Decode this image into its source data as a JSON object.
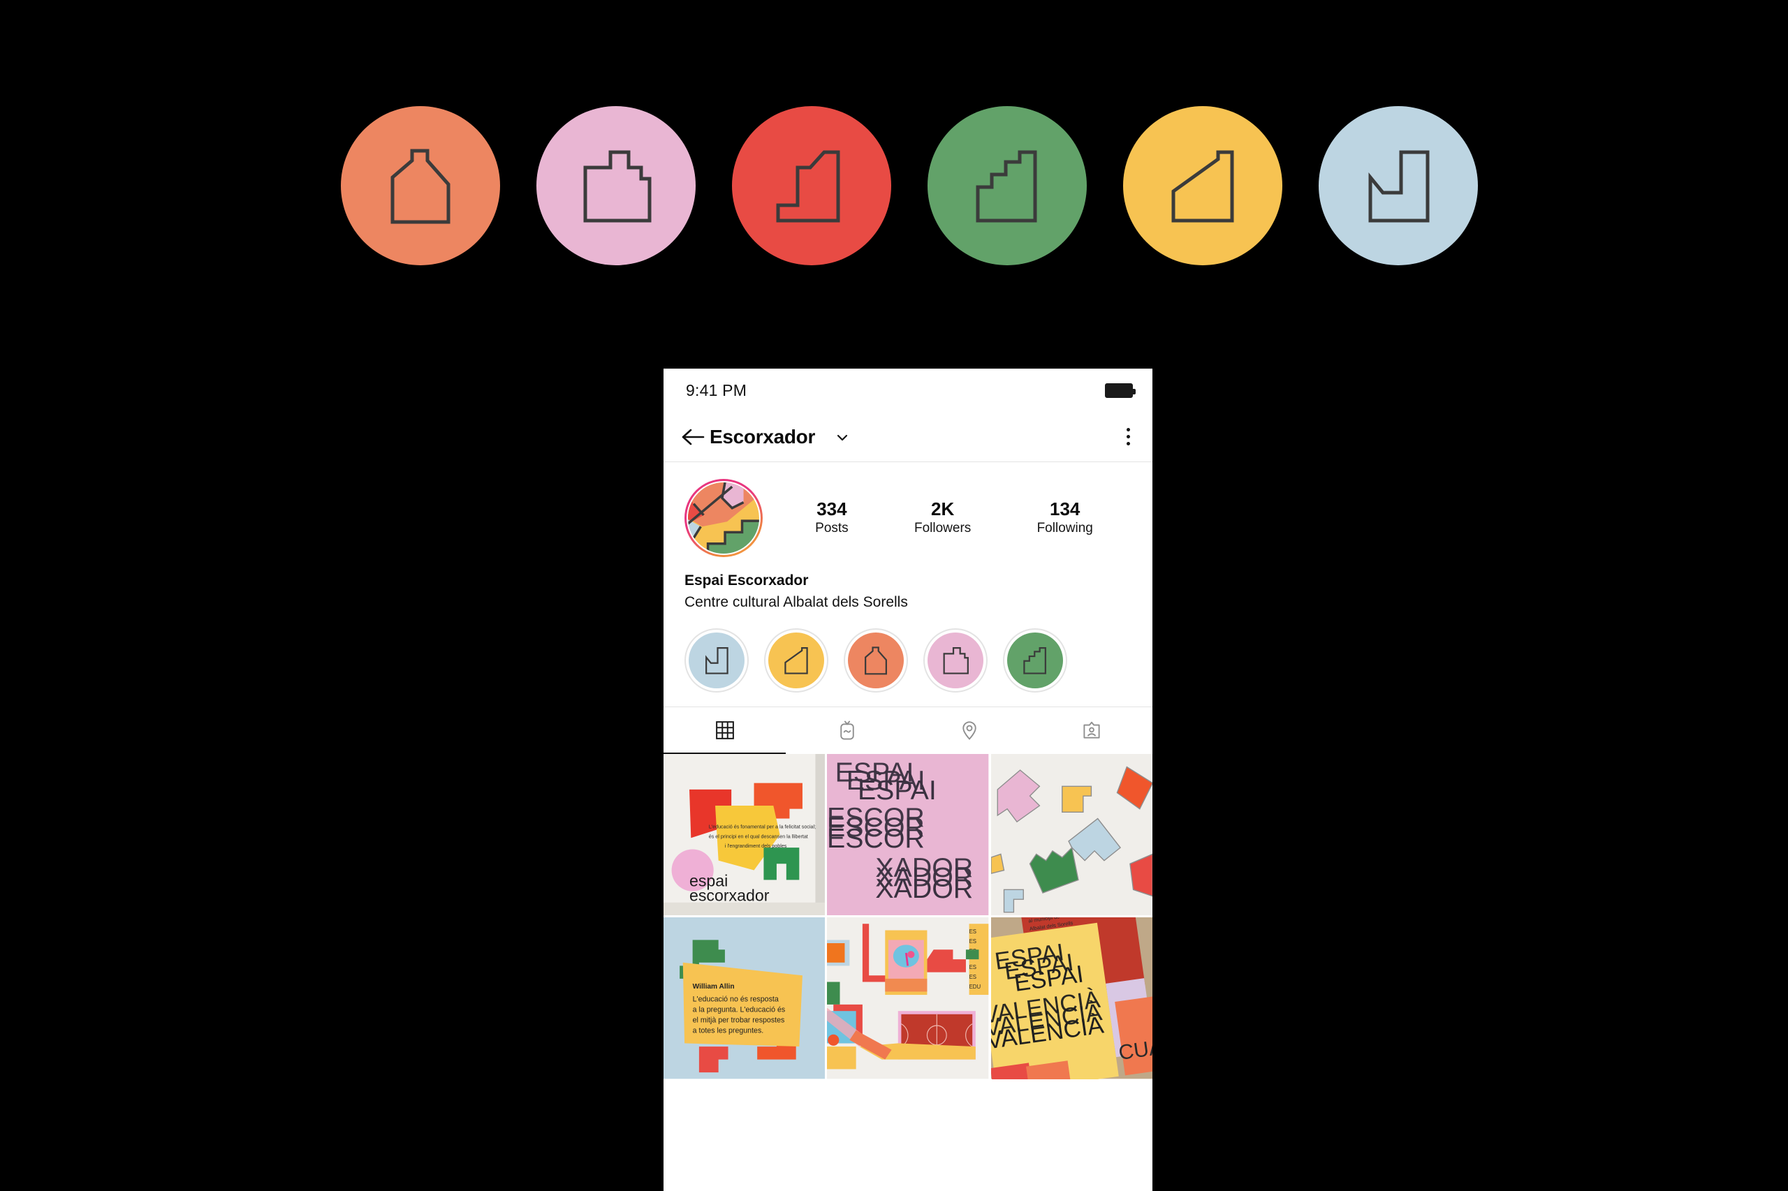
{
  "brand": {
    "palette": {
      "salmon": "#ED8661",
      "pink": "#E9B6D3",
      "red": "#E84B44",
      "green": "#62A269",
      "yellow": "#F7C352",
      "lightblue": "#BDD5E2",
      "outline": "#3B3B3B",
      "cream": "#F0EEEA"
    },
    "logo_marks": [
      {
        "name": "house-silhouette-mark",
        "color": "#ED8661"
      },
      {
        "name": "stepped-block-mark",
        "color": "#E9B6D3"
      },
      {
        "name": "tall-step-mark",
        "color": "#E84B44"
      },
      {
        "name": "staircase-mark",
        "color": "#62A269"
      },
      {
        "name": "ramp-mark",
        "color": "#F7C352"
      },
      {
        "name": "notch-mark",
        "color": "#BDD5E2"
      }
    ]
  },
  "phone": {
    "status": {
      "time": "9:41 PM",
      "battery_icon": "battery-full-icon"
    },
    "nav": {
      "back_icon": "back-arrow-icon",
      "title": "Escorxador",
      "dropdown_icon": "chevron-down-icon",
      "menu_icon": "kebab-menu-icon"
    },
    "profile": {
      "avatar_name": "profile-avatar",
      "stats": [
        {
          "value": "334",
          "label": "Posts"
        },
        {
          "value": "2K",
          "label": "Followers"
        },
        {
          "value": "134",
          "label": "Following"
        }
      ],
      "display_name": "Espai Escorxador",
      "bio": "Centre cultural Albalat dels Sorells"
    },
    "highlights": [
      {
        "name": "highlight-notch",
        "color": "#BDD5E2",
        "shape": "notch"
      },
      {
        "name": "highlight-ramp",
        "color": "#F7C352",
        "shape": "ramp"
      },
      {
        "name": "highlight-house",
        "color": "#ED8661",
        "shape": "house"
      },
      {
        "name": "highlight-stepped",
        "color": "#E9B6D3",
        "shape": "stepped"
      },
      {
        "name": "highlight-staircase",
        "color": "#62A269",
        "shape": "staircase"
      }
    ],
    "tabs": [
      {
        "name": "tab-grid",
        "icon": "grid-icon",
        "active": true
      },
      {
        "name": "tab-igtv",
        "icon": "tv-icon",
        "active": false
      },
      {
        "name": "tab-guides",
        "icon": "location-pin-icon",
        "active": false
      },
      {
        "name": "tab-tagged",
        "icon": "tagged-person-icon",
        "active": false
      }
    ],
    "grid_posts": [
      {
        "name": "post-wall-mural",
        "type": "mural",
        "brand_text_line1": "espai",
        "brand_text_line2": "escorxador",
        "quote": "L'educació és fonamental per a la felicitat social; és el principi en el qual descansen la llibertat i l'engrandiment dels pobles"
      },
      {
        "name": "post-typographic-poster",
        "type": "typography",
        "background": "#E9B6D3",
        "lines": [
          "ESPAI",
          "ESCOR",
          "XADOR"
        ]
      },
      {
        "name": "post-scattered-shapes",
        "type": "shapes",
        "background": "#F0EEEA"
      },
      {
        "name": "post-quote-card",
        "type": "quote",
        "background": "#BDD5E2",
        "author": "William Allin",
        "quote_lines": [
          "L'educació no és resposta",
          "a la pregunta. L'educació és",
          "el mitjà per trobar respostes",
          "a totes les preguntes."
        ]
      },
      {
        "name": "post-abstract-collage",
        "type": "collage",
        "background": "#F0EEEA"
      },
      {
        "name": "post-valencia-posters",
        "type": "posters",
        "lines": [
          "ESPAI",
          "VALENCIÀ"
        ],
        "caption": "al municipi de Albalat dels Sorells"
      }
    ]
  }
}
